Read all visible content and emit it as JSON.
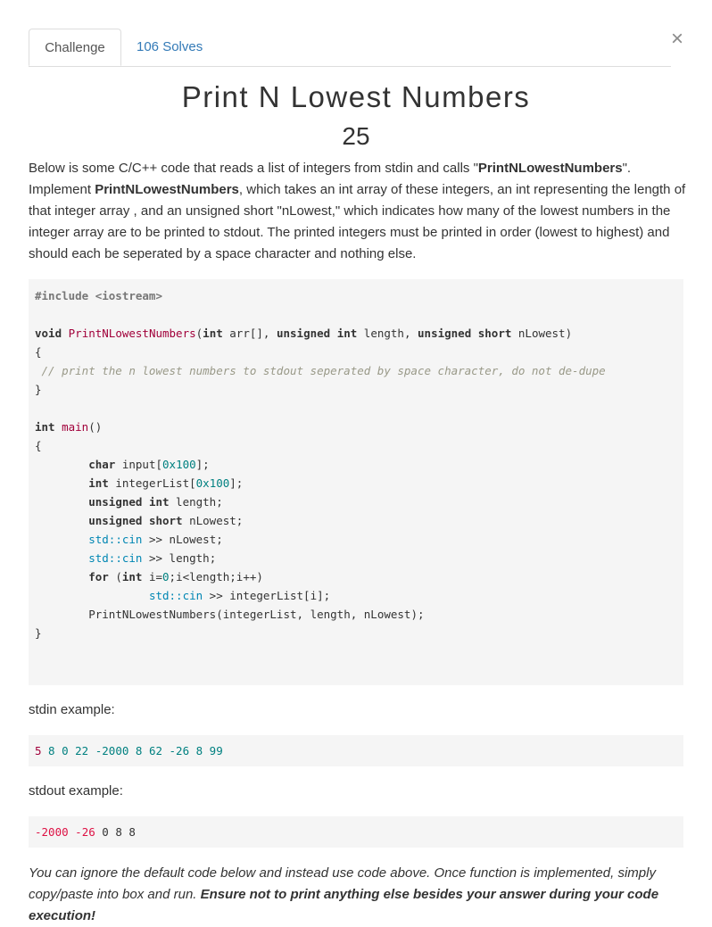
{
  "dialog": {
    "close_label": "×"
  },
  "tabs": [
    {
      "label": "Challenge",
      "active": true
    },
    {
      "label": "106 Solves",
      "active": false
    }
  ],
  "challenge": {
    "title": "Print N Lowest Numbers",
    "points": "25"
  },
  "description": {
    "p1": "Below is some C/C++ code that reads a list of integers from stdin and calls \"",
    "b1": "PrintNLowestNumbers",
    "p2": "\". Implement ",
    "b2": "PrintNLowestNumbers",
    "p3": ", which takes an int array of these integers, an int representing the length of that integer array , and an unsigned short \"nLowest,\" which indicates how many of the lowest numbers in the integer array are to be printed to stdout. The printed integers must be printed in order (lowest to highest) and should each be seperated by a space character and nothing else."
  },
  "code": {
    "include": "#include <iostream>",
    "sig_kw_void": "void",
    "sig_fn": "PrintNLowestNumbers",
    "sig_rest_1": "(",
    "sig_kw_int": "int",
    "sig_rest_2": " arr[], ",
    "sig_kw_unsigned_int": "unsigned int",
    "sig_rest_3": " length, ",
    "sig_kw_unsigned_short": "unsigned short",
    "sig_rest_4": " nLowest)",
    "open_brace": "{",
    "comment": " // print the n lowest numbers to stdout seperated by space character, do not de-dupe",
    "close_brace": "}",
    "main_kw_int": "int",
    "main_fn": "main",
    "main_parens": "()",
    "l1_kw": "char",
    "l1_rest_a": " input[",
    "l1_num": "0x100",
    "l1_rest_b": "];",
    "l2_kw": "int",
    "l2_rest_a": " integerList[",
    "l2_num": "0x100",
    "l2_rest_b": "];",
    "l3_kw": "unsigned int",
    "l3_rest": " length;",
    "l4_kw": "unsigned short",
    "l4_rest": " nLowest;",
    "l5_ns": "std::cin",
    "l5_rest": " >> nLowest;",
    "l6_ns": "std::cin",
    "l6_rest": " >> length;",
    "l7_kw_for": "for",
    "l7_rest_a": " (",
    "l7_kw_int": "int",
    "l7_rest_b": " i=",
    "l7_num": "0",
    "l7_rest_c": ";i<length;i++)",
    "l8_ns": "std::cin",
    "l8_rest": " >> integerList[i];",
    "l9": "PrintNLowestNumbers(integerList, length, nLowest);"
  },
  "stdin_example": {
    "label": "stdin example:",
    "first": "5",
    "rest": " 8 0 22 -2000 8 62 -26 8 99"
  },
  "stdout_example": {
    "label": "stdout example:",
    "neg1": "-2000",
    "sp1": " ",
    "neg2": "-26",
    "rest": " 0 8 8"
  },
  "footer": {
    "italic": "You can ignore the default code below and instead use code above. Once function is implemented, simply copy/paste into box and run. ",
    "bold_italic": "Ensure not to print anything else besides your answer during your code execution!"
  }
}
